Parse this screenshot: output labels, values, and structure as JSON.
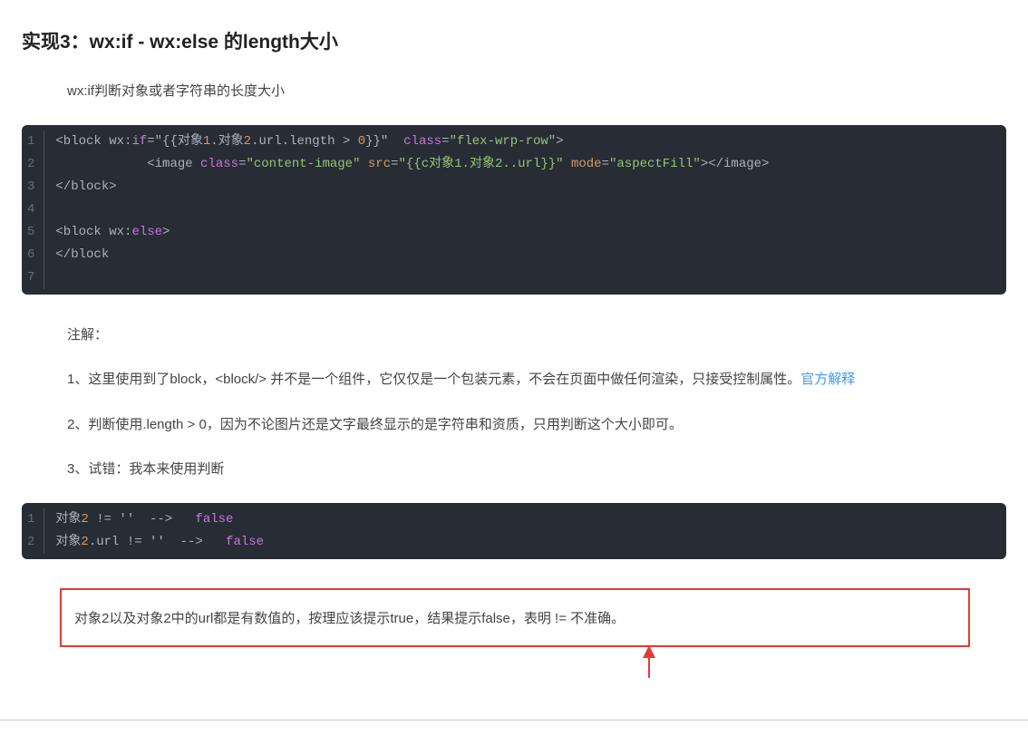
{
  "heading": "实现3：wx:if - wx:else 的length大小",
  "intro": "wx:if判断对象或者字符串的长度大小",
  "code1": {
    "line_numbers": [
      "1",
      "2",
      "3",
      "4",
      "5",
      "6",
      "7"
    ],
    "l1": {
      "open": "<block",
      "attr_wx": " wx:",
      "if_kw": "if",
      "eq_open": "=\"{{对象",
      "n1": "1",
      "dot_open": ".对象",
      "n2": "2",
      "url_len": ".url.length > ",
      "zero": "0",
      "close1": "}}\"",
      "class_sp": "  ",
      "class_kw": "class",
      "class_eq": "=",
      "class_val": "\"flex-wrp-row\"",
      "gt": ">"
    },
    "l2": {
      "indent": "            ",
      "img_open": "<image ",
      "class_kw": "class",
      "class_eq": "=",
      "class_val": "\"content-image\"",
      "sp": " ",
      "src_attr": "src",
      "src_eq": "=",
      "src_val": "\"{{c对象1.对象2..url}}\"",
      "sp2": " ",
      "mode_attr": "mode",
      "mode_eq": "=",
      "mode_val": "\"aspectFill\"",
      "close": "></image>"
    },
    "l3": {
      "text": "</block>"
    },
    "l4": {
      "text": ""
    },
    "l5": {
      "open": "<block",
      "attr_wx": " wx:",
      "else_kw": "else",
      "gt": ">"
    },
    "l6": {
      "text": "</block"
    },
    "l7": {
      "text": ""
    }
  },
  "notes_title": "注解：",
  "note1_pre": "1、这里使用到了block，<block/> 并不是一个组件，它仅仅是一个包装元素，不会在页面中做任何渲染，只接受控制属性。",
  "note1_link": "官方解释",
  "note2": "2、判断使用.length > 0，因为不论图片还是文字最终显示的是字符串和资质，只用判断这个大小即可。",
  "note3": "3、试错：我本来使用判断",
  "code2": {
    "line_numbers": [
      "1",
      "2"
    ],
    "l1": {
      "a": "对象",
      "n": "2",
      "b": " != '' ",
      "arrow": " --> ",
      "false_kw": "  false"
    },
    "l2": {
      "a": "对象",
      "n": "2",
      "url": ".url",
      "b": " != '' ",
      "arrow": " --> ",
      "false_kw": "  false"
    }
  },
  "callout": "对象2以及对象2中的url都是有数值的，按理应该提示true，结果提示false，表明 != 不准确。"
}
